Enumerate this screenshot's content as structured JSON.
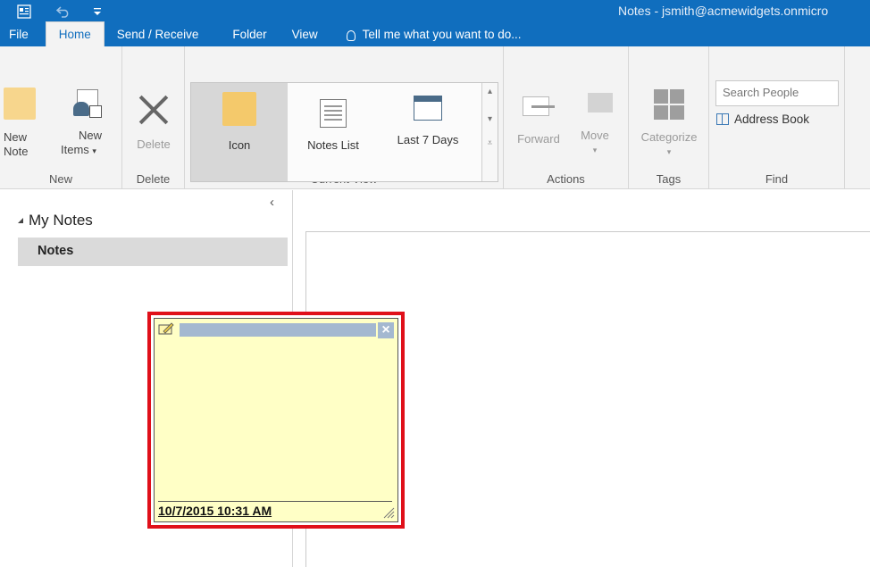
{
  "window": {
    "title": "Notes - jsmith@acmewidgets.onmicro",
    "qat": {
      "app_icon": "outlook-app-icon",
      "undo_icon": "undo-icon",
      "customize_icon": "customize-qat-icon"
    }
  },
  "tabs": [
    {
      "label": "File"
    },
    {
      "label": "Home",
      "active": true
    },
    {
      "label": "Send / Receive"
    },
    {
      "label": "Folder"
    },
    {
      "label": "View"
    }
  ],
  "tell_me": "Tell me what you want to do...",
  "ribbon": {
    "new": {
      "new_note_line1": "New",
      "new_note_line2": "Note",
      "new_items_line1": "New",
      "new_items_line2": "Items",
      "label": "New"
    },
    "delete": {
      "button": "Delete",
      "label": "Delete"
    },
    "current_view": {
      "icon": "Icon",
      "notes_list": "Notes List",
      "last_7_days": "Last 7 Days",
      "label": "Current View"
    },
    "actions": {
      "forward": "Forward",
      "move": "Move",
      "label": "Actions"
    },
    "tags": {
      "categorize": "Categorize",
      "label": "Tags"
    },
    "find": {
      "search_placeholder": "Search People",
      "address_book": "Address Book",
      "label": "Find"
    }
  },
  "nav": {
    "group": "My Notes",
    "items": [
      {
        "label": "Notes",
        "selected": true
      }
    ]
  },
  "note": {
    "timestamp": "10/7/2015 10:31 AM"
  },
  "colors": {
    "title_bar": "#106ebe",
    "ribbon_bg": "#f3f3f3",
    "note_bg": "#ffffc6",
    "highlight": "#e0101a"
  }
}
